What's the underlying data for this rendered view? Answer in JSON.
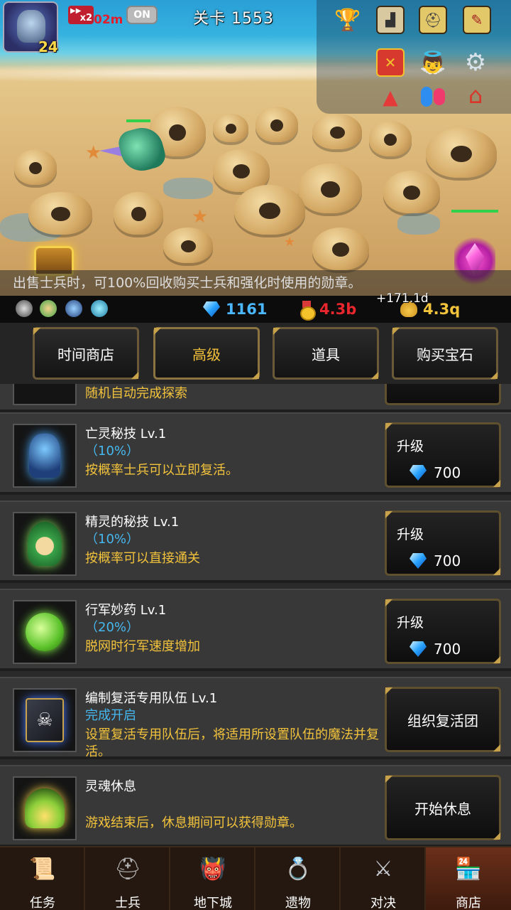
{
  "hud": {
    "level": "24",
    "speed_multiplier": "x2",
    "speed_time": "02m",
    "toggle_state": "ON",
    "stage_title": "关卡 1553"
  },
  "banner_text": "出售士兵时，可100%回收购买士兵和强化时使用的勋章。",
  "resources": {
    "gems": "1161",
    "medals": "4.3b",
    "souls": "4.3q",
    "souls_gain": "+171.1d"
  },
  "tabs": [
    {
      "label": "时间商店"
    },
    {
      "label": "高级"
    },
    {
      "label": "道具"
    },
    {
      "label": "购买宝石"
    }
  ],
  "partial_item": {
    "desc": "随机自动完成探索"
  },
  "shop_items": [
    {
      "name": "亡灵秘技 Lv.1",
      "rate": "（10%）",
      "desc": "按概率士兵可以立即复活。",
      "button_label": "升级",
      "cost": "700"
    },
    {
      "name": "精灵的秘技 Lv.1",
      "rate": "（10%）",
      "desc": "按概率可以直接通关",
      "button_label": "升级",
      "cost": "700"
    },
    {
      "name": "行军妙药 Lv.1",
      "rate": "（20%）",
      "desc": "脱网时行军速度增加",
      "button_label": "升级",
      "cost": "700"
    },
    {
      "name": "编制复活专用队伍 Lv.1",
      "rate": "完成开启",
      "desc": "设置复活专用队伍后，将适用所设置队伍的魔法并复活。",
      "button_label": "组织复活团"
    },
    {
      "name": "灵魂休息",
      "rate": "",
      "desc": "游戏结束后，休息期间可以获得勋章。",
      "button_label": "开始休息"
    }
  ],
  "bottom_nav": [
    {
      "label": "任务",
      "icon": "scroll-icon"
    },
    {
      "label": "士兵",
      "icon": "knight-helmet-icon"
    },
    {
      "label": "地下城",
      "icon": "monster-icon"
    },
    {
      "label": "遗物",
      "icon": "ring-icon"
    },
    {
      "label": "对决",
      "icon": "crossed-swords-icon"
    },
    {
      "label": "商店",
      "icon": "shop-stall-icon"
    }
  ],
  "colors": {
    "desc_gold": "#f3c33c",
    "rate_blue": "#46b8f0",
    "medal_red": "#e8262e",
    "gem_blue": "#4ab7ff"
  }
}
